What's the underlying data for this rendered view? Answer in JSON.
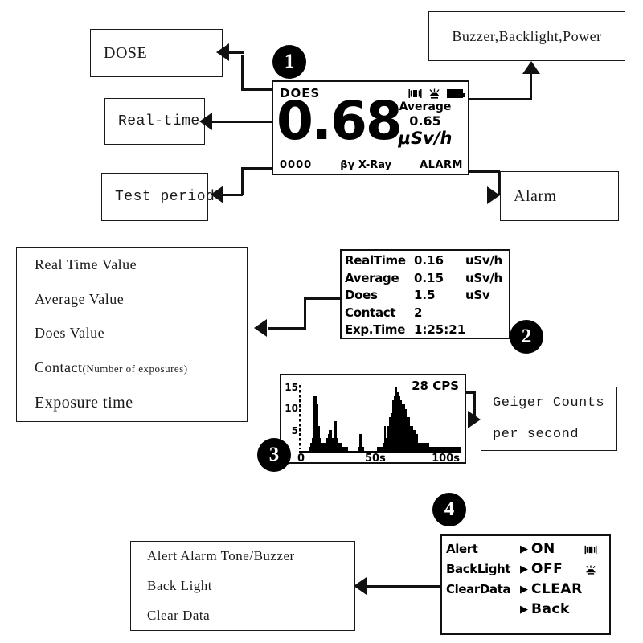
{
  "badges": [
    {
      "num": "1"
    },
    {
      "num": "2"
    },
    {
      "num": "3"
    },
    {
      "num": "4"
    }
  ],
  "callouts": {
    "dose": {
      "lines": [
        "DOSE"
      ]
    },
    "realtime": {
      "lines": [
        "Real-time"
      ]
    },
    "test_period": {
      "lines": [
        "Test period"
      ]
    },
    "buzzer_backlight_power": {
      "lines": [
        "Buzzer,Backlight,Power"
      ]
    },
    "alarm": {
      "lines": [
        "Alarm"
      ]
    },
    "values_list": {
      "lines": [
        "Real Time Value",
        "Average Value",
        "Does Value",
        "Contact",
        "Exposure time"
      ],
      "contact_note": "(Number of exposures)"
    },
    "geiger": {
      "lines": [
        "Geiger Counts",
        "per second"
      ]
    },
    "settings_list": {
      "lines": [
        "Alert Alarm Tone/Buzzer",
        "Back Light",
        "Clear Data"
      ]
    }
  },
  "lcd_main": {
    "mode": "DOES",
    "value": "0.68",
    "average_label": "Average",
    "average_value": "0.65",
    "unit": "μSv/h",
    "test_period": "0000",
    "radiation_types": "βγ X-Ray",
    "alarm": "ALARM",
    "icons": [
      "buzzer-icon",
      "backlight-icon",
      "battery-icon"
    ]
  },
  "lcd_data": {
    "rows": [
      {
        "key": "RealTime",
        "value": "0.16",
        "unit": "uSv/h"
      },
      {
        "key": "Average",
        "value": "0.15",
        "unit": "uSv/h"
      },
      {
        "key": "Does",
        "value": "1.5",
        "unit": "uSv"
      },
      {
        "key": "Contact",
        "value": "2",
        "unit": ""
      },
      {
        "key": "Exp.Time",
        "value": "1:25:21",
        "unit": ""
      }
    ]
  },
  "lcd_menu": {
    "rows": [
      {
        "key": "Alert",
        "arrow": "▶",
        "value": "ON",
        "icon": "buzzer-icon"
      },
      {
        "key": "BackLight",
        "arrow": "▶",
        "value": "OFF",
        "icon": "backlight-icon"
      },
      {
        "key": "ClearData",
        "arrow": "▶",
        "value": "CLEAR",
        "icon": ""
      }
    ],
    "back": {
      "arrow": "▶",
      "value": "Back"
    }
  },
  "chart_data": {
    "type": "bar",
    "title": "",
    "annotation": "28 CPS",
    "xlabel": "",
    "ylabel": "",
    "ylim": [
      0,
      16
    ],
    "xlim": [
      0,
      100
    ],
    "yticks": [
      5,
      10,
      15
    ],
    "ytick_labels": [
      "5",
      "10",
      "15"
    ],
    "xticks": [
      0,
      50,
      100
    ],
    "xtick_labels": [
      "0",
      "50s",
      "100s"
    ],
    "grid": false,
    "legend": "none",
    "x": [
      1,
      2,
      3,
      4,
      5,
      6,
      7,
      8,
      9,
      10,
      11,
      12,
      13,
      14,
      15,
      16,
      17,
      18,
      19,
      20,
      21,
      22,
      23,
      24,
      25,
      26,
      27,
      28,
      29,
      30,
      31,
      32,
      33,
      34,
      35,
      36,
      37,
      38,
      39,
      40,
      41,
      42,
      43,
      44,
      45,
      46,
      47,
      48,
      49,
      50,
      51,
      52,
      53,
      54,
      55,
      56,
      57,
      58,
      59,
      60,
      61,
      62,
      63,
      64,
      65,
      66,
      67,
      68,
      69,
      70,
      71,
      72,
      73,
      74,
      75,
      76,
      77,
      78,
      79,
      80,
      81,
      82,
      83,
      84,
      85,
      86,
      87,
      88,
      89,
      90,
      91,
      92,
      93,
      94,
      95,
      96,
      97,
      98,
      99,
      100
    ],
    "values": [
      0,
      0,
      0,
      0,
      1,
      2,
      3,
      13,
      13,
      11,
      6,
      3,
      2,
      2,
      2,
      3,
      4,
      5,
      5,
      3,
      7,
      7,
      3,
      2,
      2,
      1,
      1,
      1,
      1,
      0,
      0,
      0,
      0,
      0,
      0,
      1,
      4,
      4,
      1,
      0,
      0,
      0,
      0,
      0,
      0,
      0,
      0,
      1,
      2,
      1,
      1,
      2,
      6,
      3,
      6,
      8,
      9,
      12,
      13,
      15,
      14,
      13,
      12,
      11,
      11,
      10,
      8,
      8,
      6,
      6,
      5,
      5,
      4,
      2,
      2,
      2,
      2,
      2,
      2,
      2,
      1,
      1,
      1,
      1,
      1,
      1,
      1,
      1,
      1,
      1,
      1,
      1,
      1,
      1,
      1,
      1,
      1,
      1,
      1,
      1
    ]
  }
}
